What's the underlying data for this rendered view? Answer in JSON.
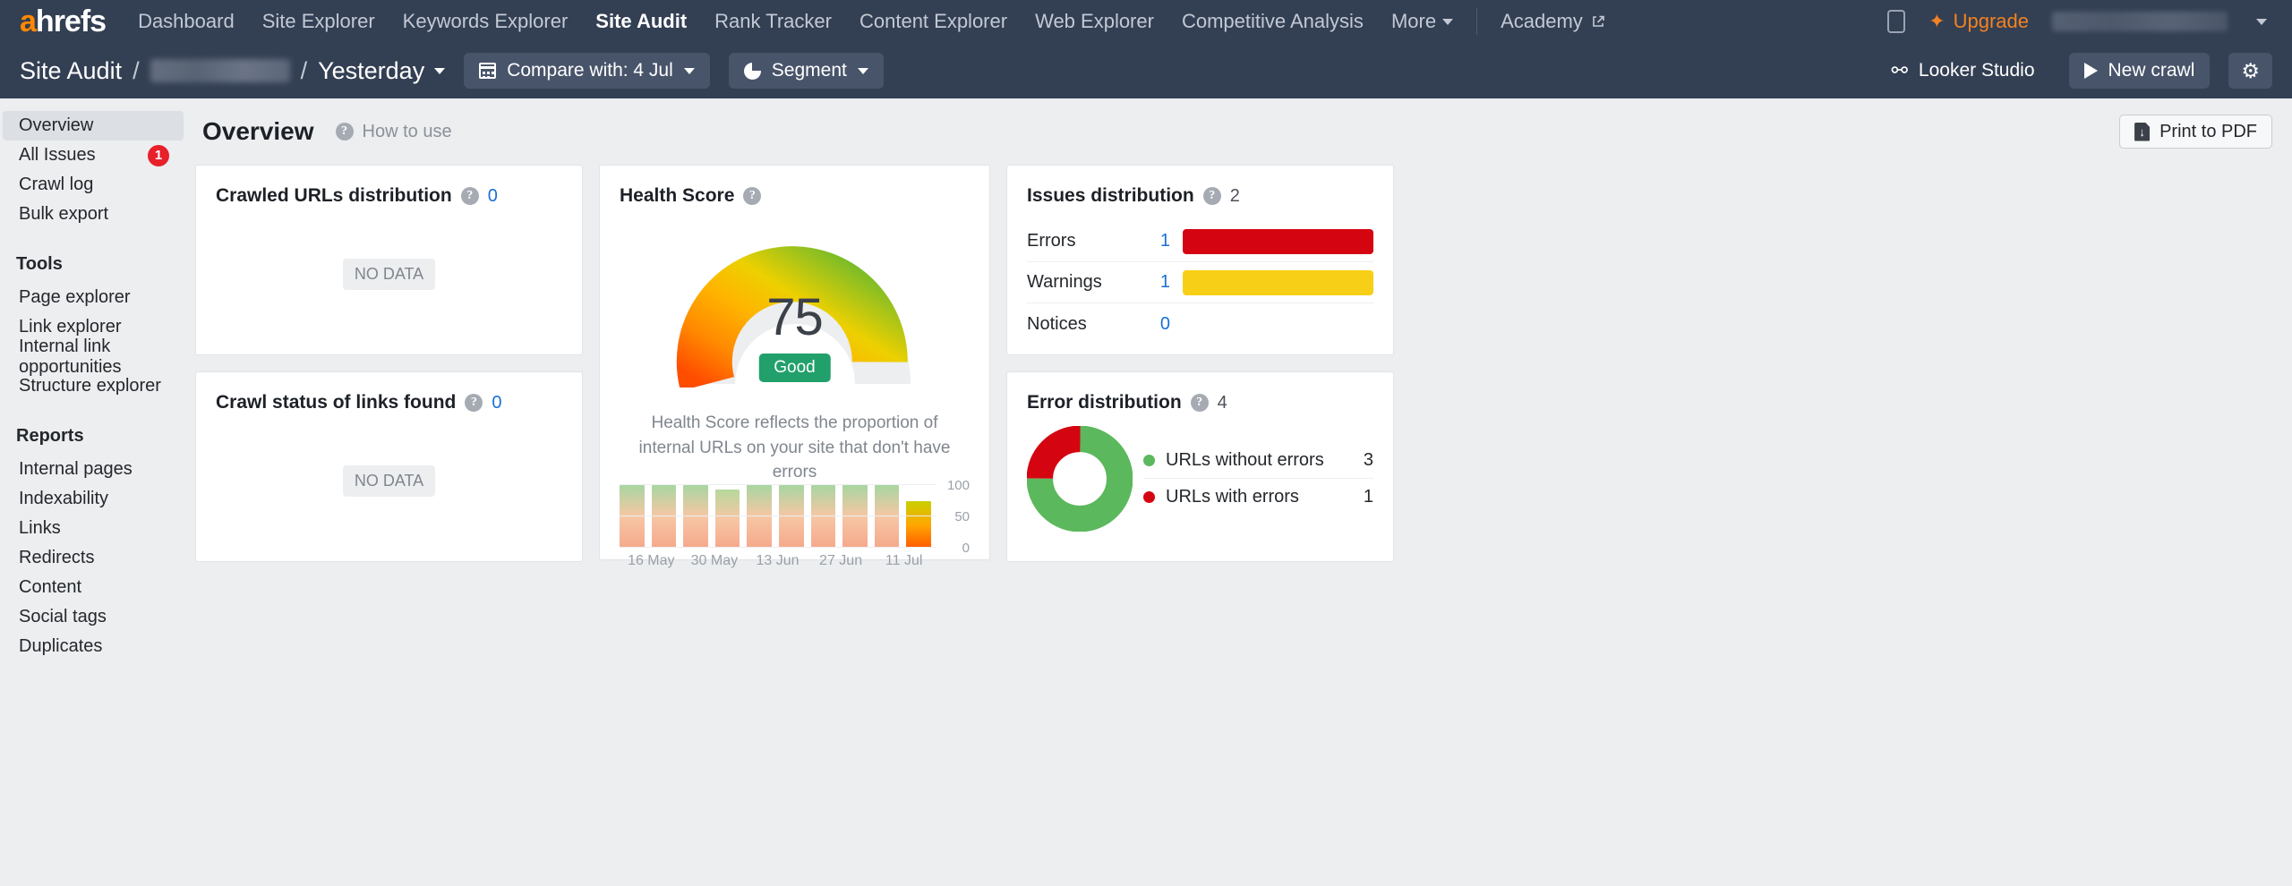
{
  "topnav": {
    "logo": "ahrefs",
    "logo_accent_letter": "a",
    "links": [
      {
        "label": "Dashboard",
        "active": false
      },
      {
        "label": "Site Explorer",
        "active": false
      },
      {
        "label": "Keywords Explorer",
        "active": false
      },
      {
        "label": "Site Audit",
        "active": true
      },
      {
        "label": "Rank Tracker",
        "active": false
      },
      {
        "label": "Content Explorer",
        "active": false
      },
      {
        "label": "Web Explorer",
        "active": false
      },
      {
        "label": "Competitive Analysis",
        "active": false
      }
    ],
    "more_label": "More",
    "academy_label": "Academy",
    "upgrade_label": "Upgrade",
    "accent_color": "#f58220",
    "bg_color": "#333f53"
  },
  "toolbar": {
    "crumb_root": "Site Audit",
    "crumb_separator": "/",
    "crumb_project_blurred": "",
    "crumb_date": "Yesterday",
    "compare_label": "Compare with: 4 Jul",
    "segment_label": "Segment",
    "looker_label": "Looker Studio",
    "new_crawl_label": "New crawl",
    "settings_label": ""
  },
  "sidebar": {
    "items": [
      {
        "label": "Overview",
        "active": true,
        "badge": null
      },
      {
        "label": "All Issues",
        "active": false,
        "badge": "1"
      },
      {
        "label": "Crawl log",
        "active": false,
        "badge": null
      },
      {
        "label": "Bulk export",
        "active": false,
        "badge": null
      }
    ],
    "tools_header": "Tools",
    "tools": [
      {
        "label": "Page explorer"
      },
      {
        "label": "Link explorer"
      },
      {
        "label": "Internal link opportunities"
      },
      {
        "label": "Structure explorer"
      }
    ],
    "reports_header": "Reports",
    "reports": [
      {
        "label": "Internal pages"
      },
      {
        "label": "Indexability"
      },
      {
        "label": "Links"
      },
      {
        "label": "Redirects"
      },
      {
        "label": "Content"
      },
      {
        "label": "Social tags"
      },
      {
        "label": "Duplicates"
      }
    ]
  },
  "main": {
    "title": "Overview",
    "how_to_use": "How to use",
    "print_to_pdf": "Print to PDF"
  },
  "cards": {
    "crawled_urls": {
      "title": "Crawled URLs distribution",
      "count": "0",
      "empty_label": "NO DATA"
    },
    "crawl_status": {
      "title": "Crawl status of links found",
      "count": "0",
      "empty_label": "NO DATA"
    },
    "health_score": {
      "title": "Health Score",
      "value": "75",
      "rating": "Good",
      "rating_color": "#22a06b",
      "description": "Health Score reflects the proportion of internal URLs on your site that don't have errors"
    },
    "issues_distribution": {
      "title": "Issues distribution",
      "count": "2",
      "rows": [
        {
          "name": "Errors",
          "value": "1",
          "color": "#d40511",
          "bar": true
        },
        {
          "name": "Warnings",
          "value": "1",
          "color": "#f7cf16",
          "bar": true
        },
        {
          "name": "Notices",
          "value": "0",
          "color": "#cfd3d8",
          "bar": false
        }
      ]
    },
    "error_distribution": {
      "title": "Error distribution",
      "count": "4",
      "legend": [
        {
          "label": "URLs without errors",
          "value": "3",
          "color": "#5cb85c"
        },
        {
          "label": "URLs with errors",
          "value": "1",
          "color": "#d40511"
        }
      ]
    }
  },
  "chart_data": [
    {
      "type": "gauge",
      "title": "Health Score",
      "value": 75,
      "min": 0,
      "max": 100,
      "rating": "Good",
      "filled_colors": [
        "#ff5a00",
        "#ffa700",
        "#f5d000",
        "#76bc21"
      ],
      "track_color": "#eceef0"
    },
    {
      "type": "bar",
      "title": "Health Score history",
      "categories": [
        "",
        "16 May",
        "",
        "30 May",
        "",
        "13 Jun",
        "",
        "27 Jun",
        "",
        "11 Jul"
      ],
      "tick_labels": [
        "16 May",
        "30 May",
        "13 Jun",
        "27 Jun",
        "11 Jul"
      ],
      "values": [
        100,
        100,
        100,
        93,
        100,
        100,
        100,
        100,
        100,
        75
      ],
      "highlight_index": 9,
      "ylim": [
        0,
        100
      ],
      "yticks": [
        0,
        50,
        100
      ],
      "ylabel": "",
      "xlabel": "",
      "grid": true
    },
    {
      "type": "bar",
      "orientation": "horizontal",
      "title": "Issues distribution",
      "categories": [
        "Errors",
        "Warnings",
        "Notices"
      ],
      "values": [
        1,
        1,
        0
      ],
      "colors": [
        "#d40511",
        "#f7cf16",
        "#cfd3d8"
      ],
      "total": 2
    },
    {
      "type": "pie",
      "variant": "donut",
      "title": "Error distribution",
      "labels": [
        "URLs without errors",
        "URLs with errors"
      ],
      "values": [
        3,
        1
      ],
      "colors": [
        "#5cb85c",
        "#d40511"
      ],
      "total": 4,
      "legend_position": "right"
    }
  ]
}
